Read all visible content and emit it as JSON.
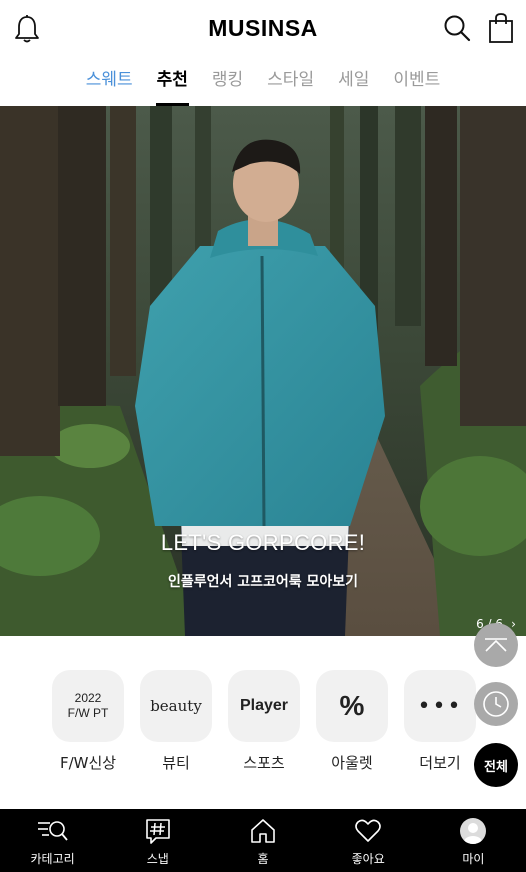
{
  "header": {
    "logo": "MUSINSA",
    "icons": [
      "bell-icon",
      "search-icon",
      "shopping-bag-icon"
    ]
  },
  "tabs": [
    {
      "label": "스웨트",
      "state": "highlight"
    },
    {
      "label": "추천",
      "state": "active"
    },
    {
      "label": "랭킹",
      "state": "normal"
    },
    {
      "label": "스타일",
      "state": "normal"
    },
    {
      "label": "세일",
      "state": "normal"
    },
    {
      "label": "이벤트",
      "state": "normal"
    }
  ],
  "hero": {
    "headline": "LET'S GORPCORE!",
    "subtitle": "인플루언서 고프코어룩 모아보기",
    "counter": "6 / 6",
    "next_icon": "chevron-right-icon"
  },
  "quick_menu": [
    {
      "icon_line1": "2022",
      "icon_line2": "F/W PT",
      "label": "F/W신상"
    },
    {
      "icon_text": "beauty",
      "label": "뷰티"
    },
    {
      "icon_text": "Player",
      "label": "스포츠"
    },
    {
      "icon_text": "%",
      "label": "아울렛"
    },
    {
      "icon_text": "•••",
      "label": "더보기"
    }
  ],
  "floating": {
    "top_icon": "scroll-top-icon",
    "recent_icon": "clock-icon",
    "all_label": "전체"
  },
  "bottom_nav": [
    {
      "label": "카테고리",
      "icon": "category-search-icon"
    },
    {
      "label": "스냅",
      "icon": "hashtag-icon"
    },
    {
      "label": "홈",
      "icon": "home-icon"
    },
    {
      "label": "좋아요",
      "icon": "heart-icon"
    },
    {
      "label": "마이",
      "icon": "avatar-icon"
    }
  ],
  "colors": {
    "accent_tab": "#4a90d9",
    "nav_bg": "#000000",
    "fab_gray": "#a9a9a9"
  }
}
